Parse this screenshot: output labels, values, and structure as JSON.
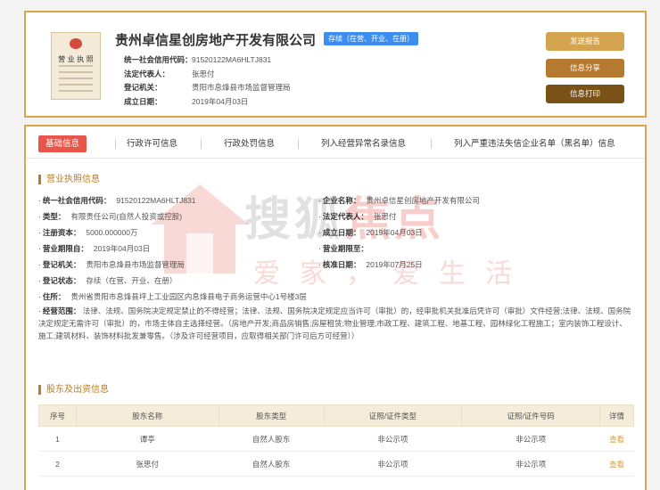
{
  "license_thumb": {
    "title": "营 业 执 照"
  },
  "company": {
    "name": "贵州卓信星创房地产开发有限公司",
    "status": "存续（在营、开业、在册）"
  },
  "header_info": [
    {
      "label": "统一社会信用代码：",
      "value": "91520122MA6HLTJ831"
    },
    {
      "label": "法定代表人：",
      "value": "张思付"
    },
    {
      "label": "登记机关：",
      "value": "贵阳市息烽县市场监督管理局"
    },
    {
      "label": "成立日期：",
      "value": "2019年04月03日"
    }
  ],
  "actions": {
    "send_report": "发送报告",
    "share": "信息分享",
    "print": "信息打印"
  },
  "colors": {
    "gold": "#d9a64a",
    "tab_active": "#e8564b",
    "status_blue": "#3b8ef0"
  },
  "tabs": [
    "基础信息",
    "行政许可信息",
    "行政处罚信息",
    "列入经营异常名录信息",
    "列入严重违法失信企业名单（黑名单）信息"
  ],
  "license_section": {
    "title": "营业执照信息",
    "left": [
      {
        "label": "统一社会信用代码：",
        "value": "91520122MA6HLTJ831"
      },
      {
        "label": "类型：",
        "value": "有限责任公司(自然人投资或控股)"
      },
      {
        "label": "注册资本：",
        "value": "5000.000000万"
      },
      {
        "label": "营业期限自：",
        "value": "2019年04月03日"
      },
      {
        "label": "登记机关：",
        "value": "贵阳市息烽县市场监督管理局"
      },
      {
        "label": "登记状态：",
        "value": "存续（在营、开业、在册）"
      },
      {
        "label": "住所：",
        "value": "贵州省贵阳市息烽县坪上工业园区内息烽县电子商务运营中心1号楼3层"
      }
    ],
    "right": [
      {
        "label": "企业名称：",
        "value": "贵州卓信星创房地产开发有限公司"
      },
      {
        "label": "法定代表人：",
        "value": "张思付"
      },
      {
        "label": "成立日期：",
        "value": "2019年04月03日"
      },
      {
        "label": "营业期限至：",
        "value": ""
      },
      {
        "label": "核准日期：",
        "value": "2019年07月25日"
      }
    ],
    "scope_label": "经营范围：",
    "scope_value": "法律、法规、国务院决定规定禁止的不得经营；法律、法规、国务院决定规定应当许可（审批）的，经审批机关批准后凭许可（审批）文件经营;法律、法规、国务院决定规定无需许可（审批）的，市场主体自主选择经营。（房地产开发;商品房销售;房屋租赁;物业管理;市政工程、建筑工程、地基工程、园林绿化工程施工；室内装饰工程设计、施工;建筑材料、装饰材料批发兼零售。（涉及许可经营项目，应取得相关部门许可后方可经营））"
  },
  "watermark": {
    "main": "搜狐",
    "accent": "焦点",
    "sub": "爱家，爱生活"
  },
  "shareholders": {
    "title": "股东及出资信息",
    "headers": [
      "序号",
      "股东名称",
      "股东类型",
      "证照/证件类型",
      "证照/证件号码",
      "详情"
    ],
    "rows": [
      [
        "1",
        "谭亭",
        "自然人股东",
        "非公示项",
        "非公示项",
        "查看"
      ],
      [
        "2",
        "张思付",
        "自然人股东",
        "非公示项",
        "非公示项",
        "查看"
      ]
    ]
  }
}
